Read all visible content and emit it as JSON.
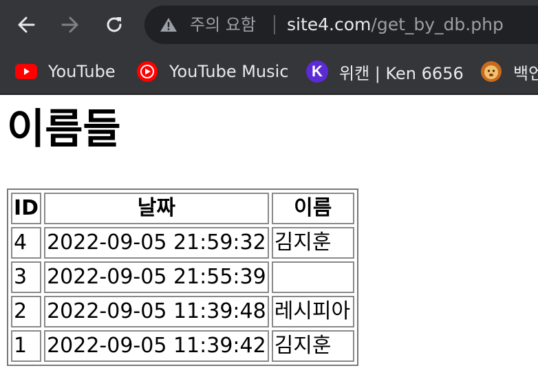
{
  "browser": {
    "security_label": "주의 요함",
    "url_host": "site4.com",
    "url_path": "/get_by_db.php",
    "bookmarks": [
      {
        "label": "YouTube",
        "icon": "youtube-icon"
      },
      {
        "label": "YouTube Music",
        "icon": "youtube-music-icon"
      },
      {
        "label": "위캔 | Ken 6656",
        "icon_letter": "K",
        "icon": "k-logo-icon"
      },
      {
        "label": "백언",
        "icon": "lion-icon"
      }
    ]
  },
  "page": {
    "title": "이름들",
    "table": {
      "headers": [
        "ID",
        "날짜",
        "이름"
      ],
      "rows": [
        [
          "4",
          "2022-09-05 21:59:32",
          "김지훈"
        ],
        [
          "3",
          "2022-09-05 21:55:39",
          ""
        ],
        [
          "2",
          "2022-09-05 11:39:48",
          "레시피아"
        ],
        [
          "1",
          "2022-09-05 11:39:42",
          "김지훈"
        ]
      ]
    }
  },
  "colors": {
    "chrome": "#35363a",
    "omnibox": "#202124",
    "youtube_red": "#ff0000",
    "k_logo_purple": "#5b2bd6"
  }
}
